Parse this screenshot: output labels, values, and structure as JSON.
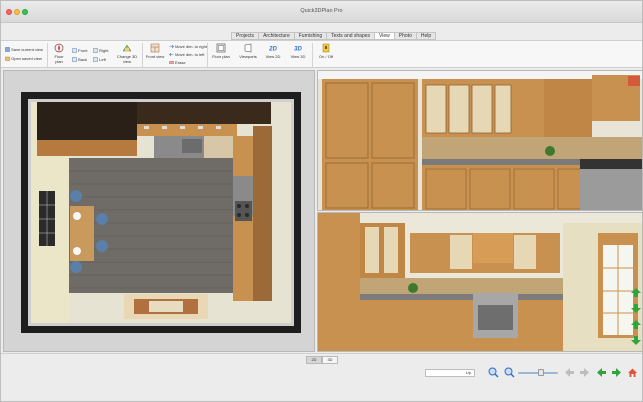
{
  "window": {
    "title": "Quick3DPlan Pro"
  },
  "tabs": [
    {
      "label": "Projects",
      "active": false
    },
    {
      "label": "Architecture",
      "active": false
    },
    {
      "label": "Furnishing",
      "active": false
    },
    {
      "label": "Texts and shapes",
      "active": false
    },
    {
      "label": "View",
      "active": true
    },
    {
      "label": "Photo",
      "active": false
    },
    {
      "label": "Help",
      "active": false
    }
  ],
  "ribbon": {
    "save_current_view": "Save current view",
    "open_saved_view": "Open saved view",
    "floor_plan_small": "Floor plan",
    "front": "Front",
    "right": "Right",
    "back": "Back",
    "left": "Left",
    "change_3d_view": "Change 3D view",
    "front_view": "Front view",
    "move_dim_right": "Move dim. to right",
    "move_dim_left": "Move dim. to left",
    "erase": "Erase",
    "floor_plan": "Floor plan",
    "viewports": "Viewports",
    "view_2d": "View 2D",
    "view_3d": "View 3D",
    "on_off": "On / Off"
  },
  "bottom": {
    "mode_2d": "2D",
    "mode_3d": "3D",
    "level_value": "Up"
  },
  "colors": {
    "accent": "#2f6fd0",
    "nav_green": "#2fa43a",
    "wood": "#c9914f",
    "counter": "#6b6b6b",
    "wall": "#d9d3b6"
  }
}
